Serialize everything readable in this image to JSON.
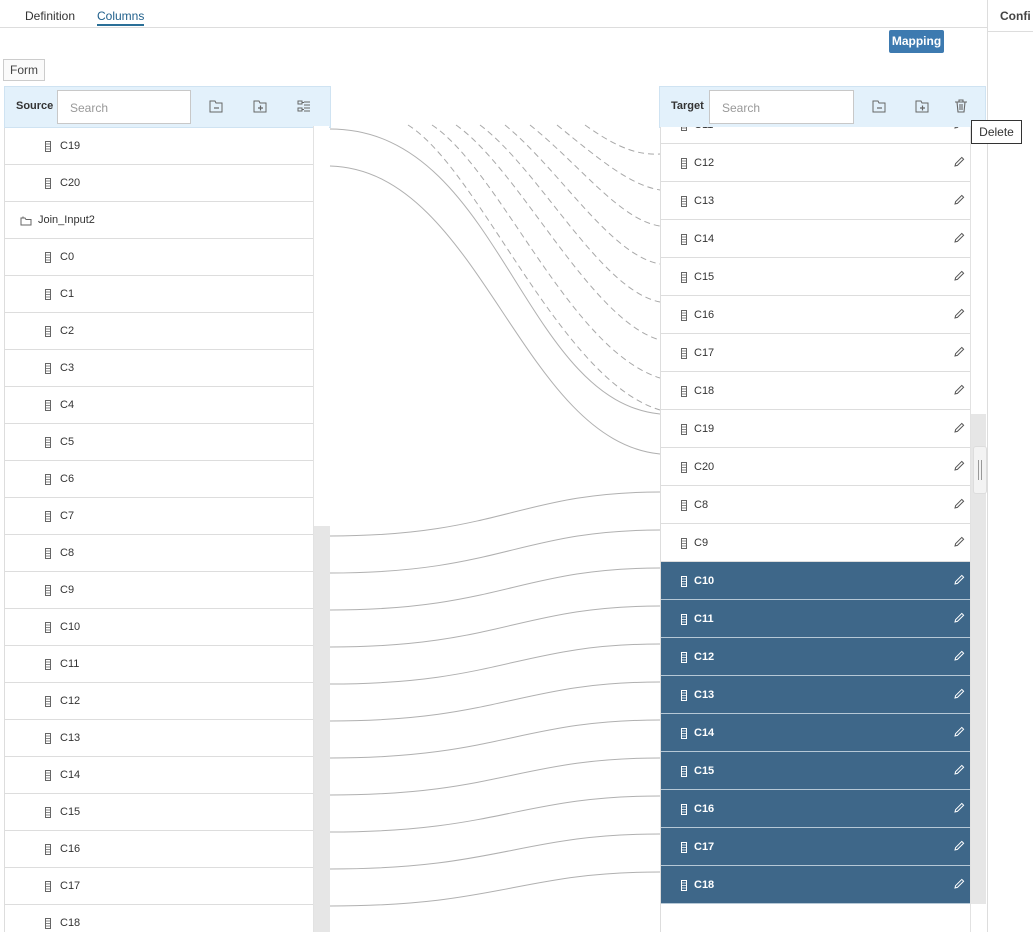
{
  "tabs": [
    {
      "label": "Definition",
      "active": false
    },
    {
      "label": "Columns",
      "active": true
    }
  ],
  "right_pane": {
    "header": "Confi"
  },
  "mapping_button": "Mapping",
  "form_label": "Form",
  "source": {
    "label": "Source",
    "search_placeholder": "Search",
    "rows": [
      {
        "label": "C19",
        "kind": "column"
      },
      {
        "label": "C20",
        "kind": "column"
      },
      {
        "label": "Join_Input2",
        "kind": "group"
      },
      {
        "label": "C0",
        "kind": "column"
      },
      {
        "label": "C1",
        "kind": "column"
      },
      {
        "label": "C2",
        "kind": "column"
      },
      {
        "label": "C3",
        "kind": "column"
      },
      {
        "label": "C4",
        "kind": "column"
      },
      {
        "label": "C5",
        "kind": "column"
      },
      {
        "label": "C6",
        "kind": "column"
      },
      {
        "label": "C7",
        "kind": "column"
      },
      {
        "label": "C8",
        "kind": "column"
      },
      {
        "label": "C9",
        "kind": "column"
      },
      {
        "label": "C10",
        "kind": "column"
      },
      {
        "label": "C11",
        "kind": "column"
      },
      {
        "label": "C12",
        "kind": "column"
      },
      {
        "label": "C13",
        "kind": "column"
      },
      {
        "label": "C14",
        "kind": "column"
      },
      {
        "label": "C15",
        "kind": "column"
      },
      {
        "label": "C16",
        "kind": "column"
      },
      {
        "label": "C17",
        "kind": "column"
      },
      {
        "label": "C18",
        "kind": "column"
      }
    ]
  },
  "target": {
    "label": "Target",
    "search_placeholder": "Search",
    "partial_top_row": "C11",
    "rows": [
      {
        "label": "C12",
        "selected": false
      },
      {
        "label": "C13",
        "selected": false
      },
      {
        "label": "C14",
        "selected": false
      },
      {
        "label": "C15",
        "selected": false
      },
      {
        "label": "C16",
        "selected": false
      },
      {
        "label": "C17",
        "selected": false
      },
      {
        "label": "C18",
        "selected": false
      },
      {
        "label": "C19",
        "selected": false
      },
      {
        "label": "C20",
        "selected": false
      },
      {
        "label": "C8",
        "selected": false
      },
      {
        "label": "C9",
        "selected": false
      },
      {
        "label": "C10",
        "selected": true
      },
      {
        "label": "C11",
        "selected": true
      },
      {
        "label": "C12",
        "selected": true
      },
      {
        "label": "C13",
        "selected": true
      },
      {
        "label": "C14",
        "selected": true
      },
      {
        "label": "C15",
        "selected": true
      },
      {
        "label": "C16",
        "selected": true
      },
      {
        "label": "C17",
        "selected": true
      },
      {
        "label": "C18",
        "selected": true
      }
    ]
  },
  "tooltip": "Delete",
  "icons": {
    "collapse": "collapse-all-icon",
    "expand": "expand-all-icon",
    "auto_map": "auto-map-icon",
    "delete": "trash-icon",
    "column": "column-icon",
    "group": "table-group-icon",
    "edit": "pencil-icon"
  },
  "colors": {
    "selected_row": "#3e6789",
    "header_bg": "#e3f1fb",
    "mapping_button": "#3d7ab0",
    "accent": "#2a6f97"
  }
}
